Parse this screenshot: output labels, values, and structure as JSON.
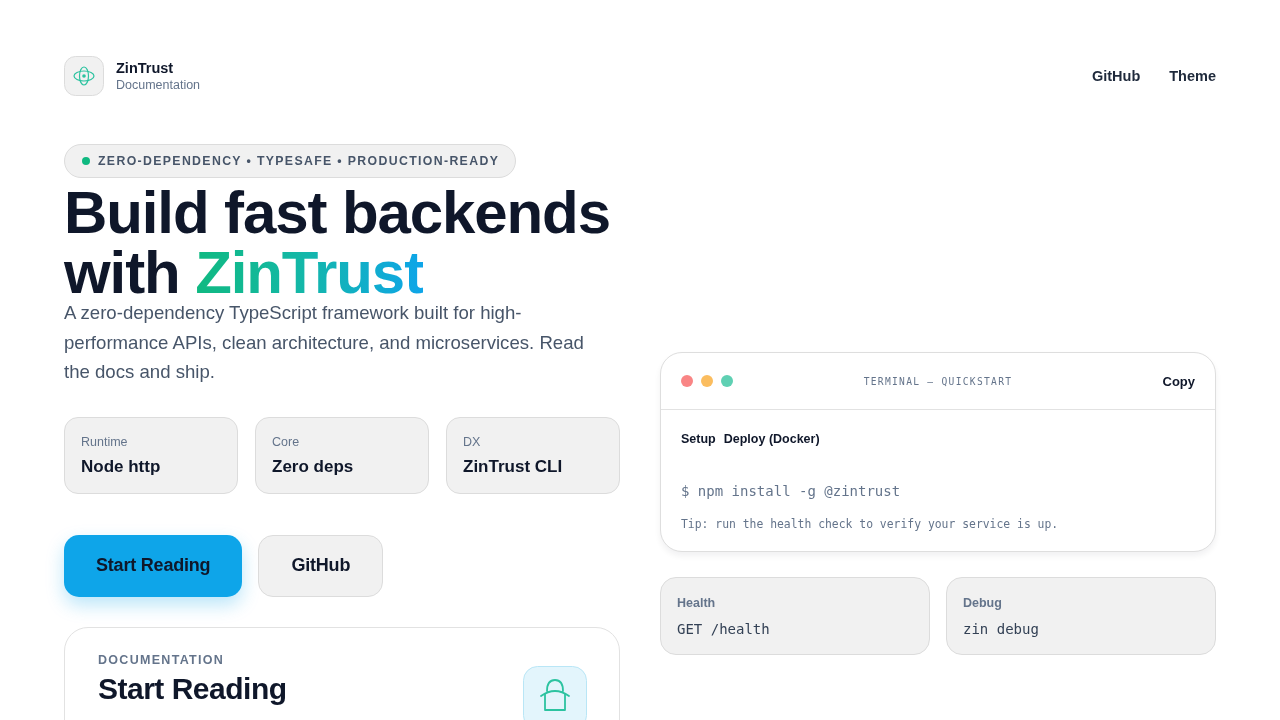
{
  "header": {
    "brand": {
      "name": "ZinTrust",
      "subtitle": "Documentation"
    },
    "nav": [
      "GitHub",
      "Theme"
    ]
  },
  "hero": {
    "tagline": "ZERO-DEPENDENCY • TYPESAFE • PRODUCTION-READY",
    "heading": {
      "line_1": "Build fast backends",
      "line_2": "with",
      "highlight": "ZinTrust"
    },
    "description": "A zero-dependency TypeScript framework built for high-performance APIs, clean architecture, and microservices. Read the docs and ship.",
    "stats": [
      {
        "label": "Runtime",
        "value": "Node http"
      },
      {
        "label": "Core",
        "value": "Zero deps"
      },
      {
        "label": "DX",
        "value": "ZinTrust CLI"
      }
    ],
    "buttons": [
      {
        "label": "Start Reading",
        "kind": "primary"
      },
      {
        "label": "GitHub",
        "kind": "secondary"
      }
    ]
  },
  "doc_card": {
    "eyebrow": "DOCUMENTATION",
    "title": "Start Reading"
  },
  "terminal": {
    "title": "TERMINAL — QUICKSTART",
    "copy_label": "Copy",
    "tabs": [
      "Setup",
      "Deploy (Docker)"
    ],
    "command": "$ npm install -g @zintrust",
    "tip": "Tip: run the health check to verify your service is up."
  },
  "info_cards": [
    {
      "label": "Health",
      "value": "GET /health"
    },
    {
      "label": "Debug",
      "value": "zin debug"
    }
  ]
}
